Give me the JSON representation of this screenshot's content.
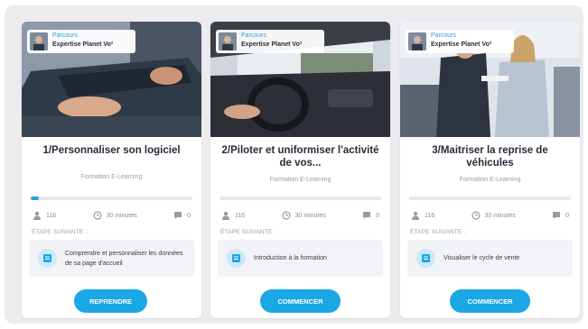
{
  "cards": [
    {
      "badge_type": "Parcours",
      "badge_title": "Expertise Planet Vo²",
      "title": "1/Personnaliser son logiciel",
      "subtitle": "Formation E-Learning",
      "progress": 0.05,
      "stats": {
        "learners": "116",
        "duration": "30 minutes",
        "comments": "0"
      },
      "next_label": "ÉTAPE SUIVANTE :",
      "next_text": "Comprendre et personnaliser les données de sa page d'accueil",
      "button": "REPRENDRE"
    },
    {
      "badge_type": "Parcours",
      "badge_title": "Expertise Planet Vo²",
      "title": "2/Piloter et uniformiser l'activité de vos...",
      "subtitle": "Formation E-Learning",
      "progress": 0,
      "stats": {
        "learners": "116",
        "duration": "30 minutes",
        "comments": "0"
      },
      "next_label": "ÉTAPE SUIVANTE :",
      "next_text": "Introduction à la formation",
      "button": "COMMENCER"
    },
    {
      "badge_type": "Parcours",
      "badge_title": "Expertise Planet Vo²",
      "title": "3/Maitriser la reprise de véhicules",
      "subtitle": "Formation E-Learning",
      "progress": 0,
      "stats": {
        "learners": "116",
        "duration": "30 minutes",
        "comments": "0"
      },
      "next_label": "ÉTAPE SUIVANTE :",
      "next_text": "Visualiser le cycle de vente",
      "button": "COMMENCER"
    }
  ],
  "colors": {
    "accent": "#1aa7e6",
    "panel": "#ececee",
    "progress_track": "#e6e7ec"
  },
  "icons": [
    "user-icon",
    "clock-icon",
    "comment-icon",
    "module-icon"
  ]
}
